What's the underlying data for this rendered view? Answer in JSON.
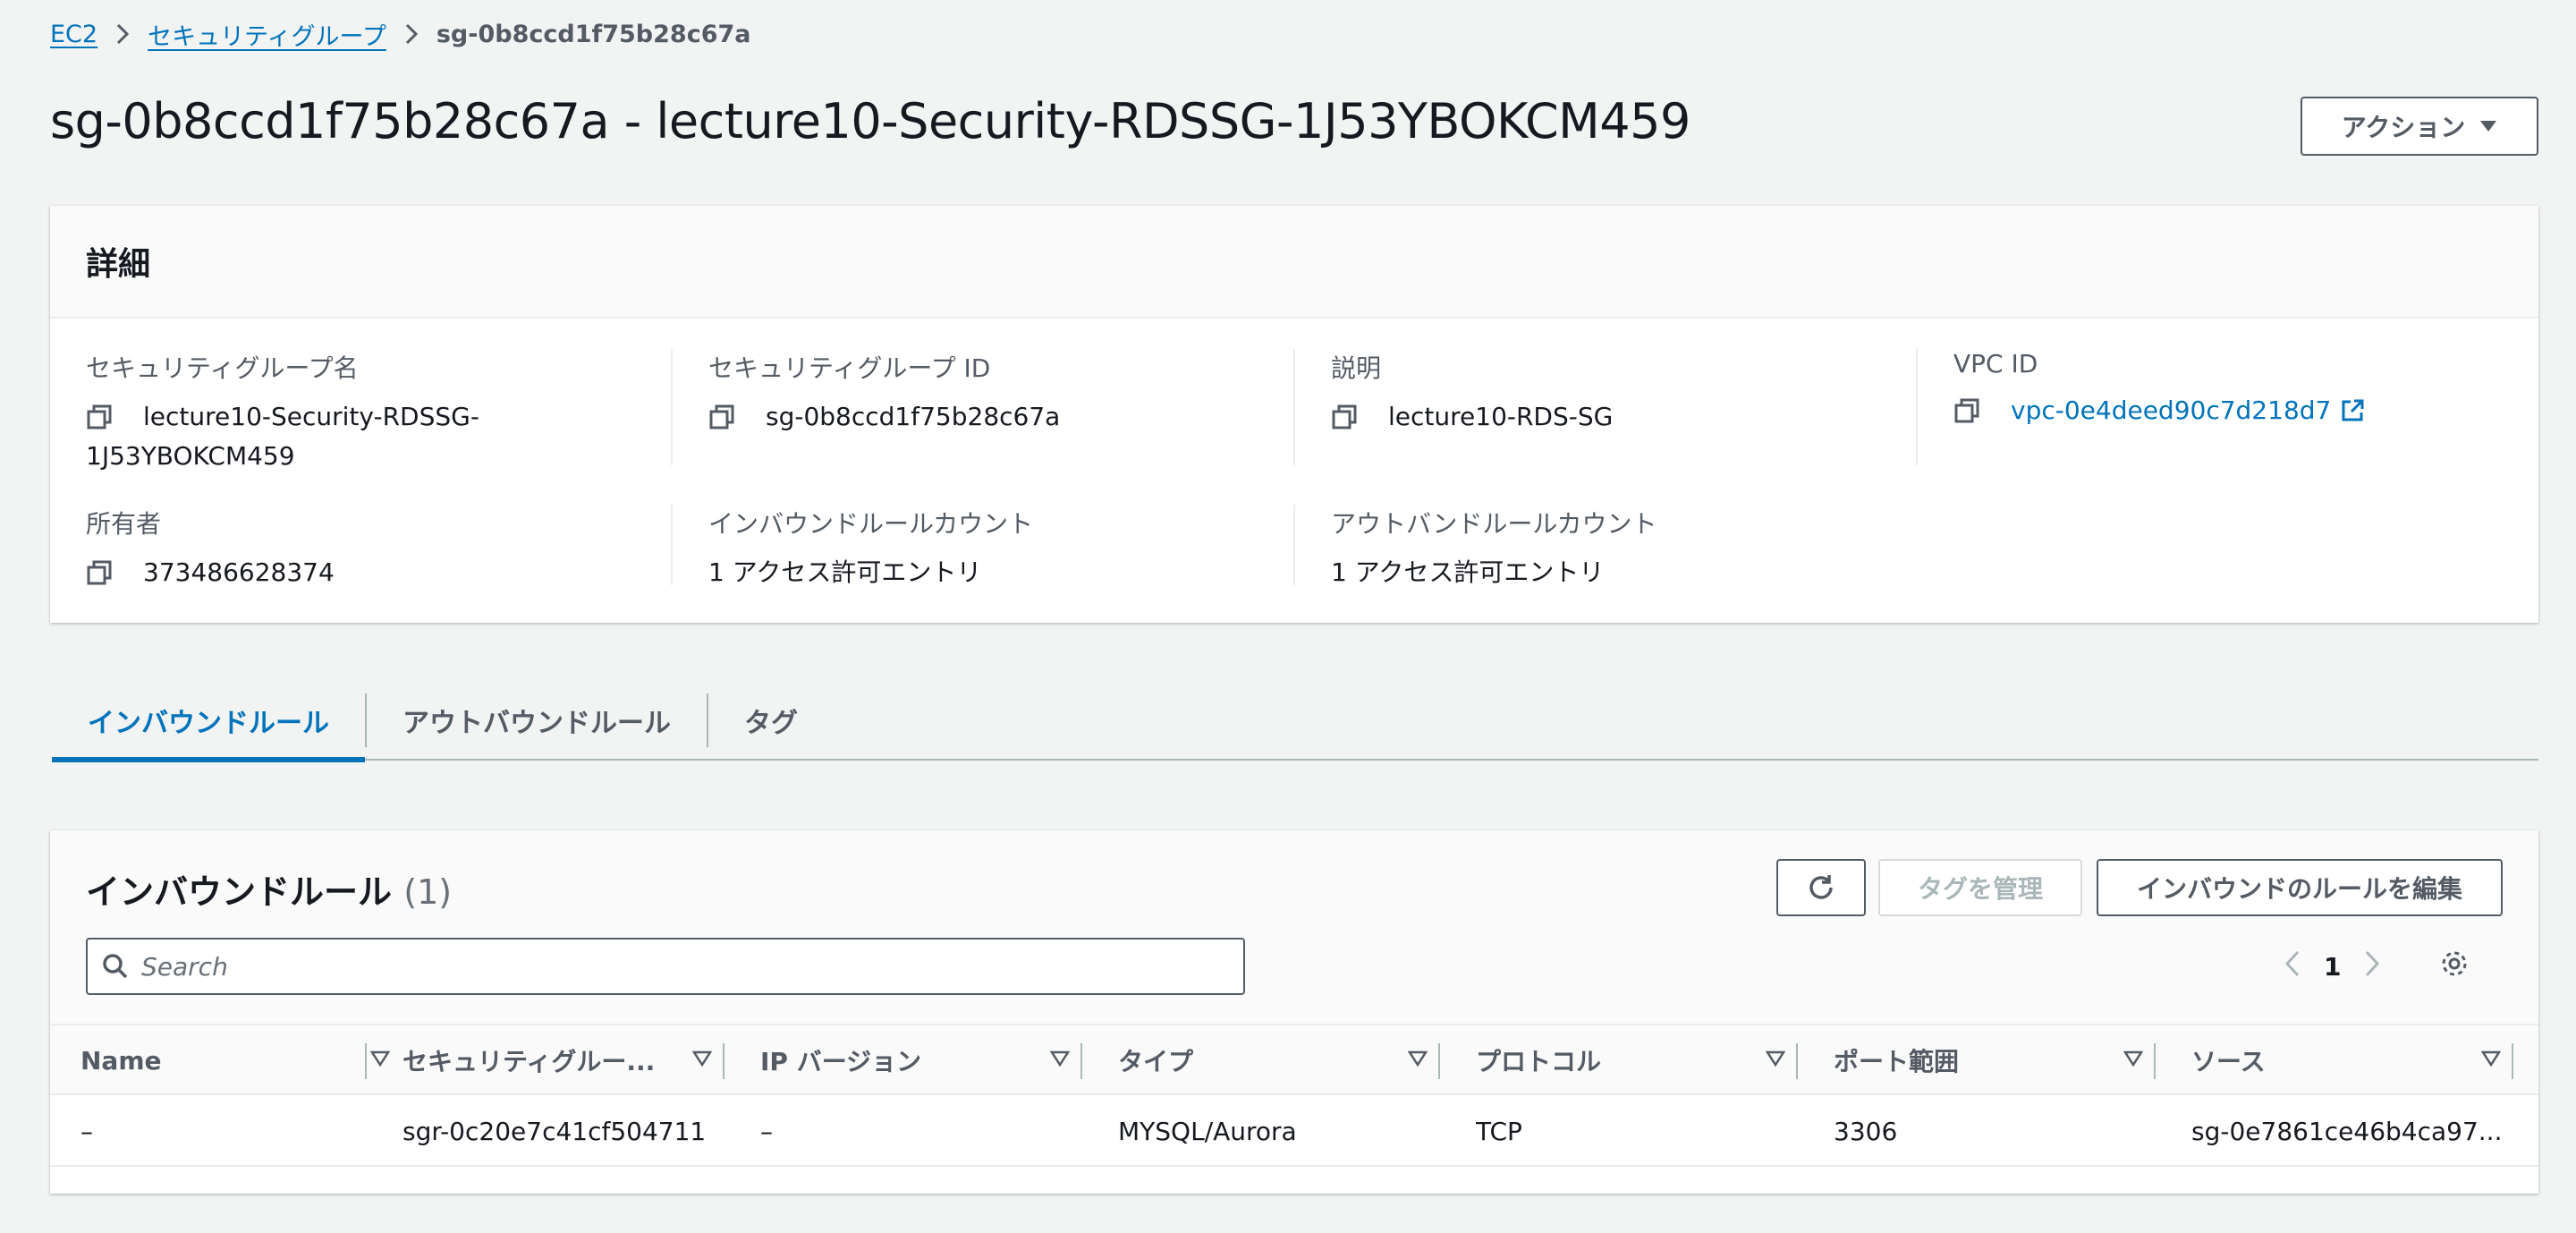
{
  "breadcrumb": {
    "ec2": "EC2",
    "security_groups": "セキュリティグループ",
    "current": "sg-0b8ccd1f75b28c67a"
  },
  "page_title": "sg-0b8ccd1f75b28c67a - lecture10-Security-RDSSG-1J53YBOKCM459",
  "actions_button": "アクション",
  "details": {
    "heading": "詳細",
    "sg_name_label": "セキュリティグループ名",
    "sg_name_line1": "lecture10-Security-RDSSG-",
    "sg_name_line2": "1J53YBOKCM459",
    "sg_id_label": "セキュリティグループ ID",
    "sg_id": "sg-0b8ccd1f75b28c67a",
    "description_label": "説明",
    "description": "lecture10-RDS-SG",
    "vpc_label": "VPC ID",
    "vpc_id": "vpc-0e4deed90c7d218d7",
    "owner_label": "所有者",
    "owner": "373486628374",
    "inbound_count_label": "インバウンドルールカウント",
    "inbound_count": "1 アクセス許可エントリ",
    "outbound_count_label": "アウトバンドルールカウント",
    "outbound_count": "1 アクセス許可エントリ"
  },
  "tabs": [
    "インバウンドルール",
    "アウトバウンドルール",
    "タグ"
  ],
  "rules": {
    "title": "インバウンドルール",
    "count": "(1)",
    "manage_tags": "タグを管理",
    "edit_rules": "インバウンドのルールを編集",
    "search_placeholder": "Search",
    "page": "1",
    "columns": [
      "Name",
      "セキュリティグルー...",
      "IP バージョン",
      "タイプ",
      "プロトコル",
      "ポート範囲",
      "ソース"
    ],
    "rows": [
      [
        "–",
        "sgr-0c20e7c41cf504711",
        "–",
        "MYSQL/Aurora",
        "TCP",
        "3306",
        "sg-0e7861ce46b4ca97..."
      ]
    ]
  },
  "colors": {
    "link": "#0073bb",
    "background": "#f2f3f3",
    "border": "#545b64"
  }
}
